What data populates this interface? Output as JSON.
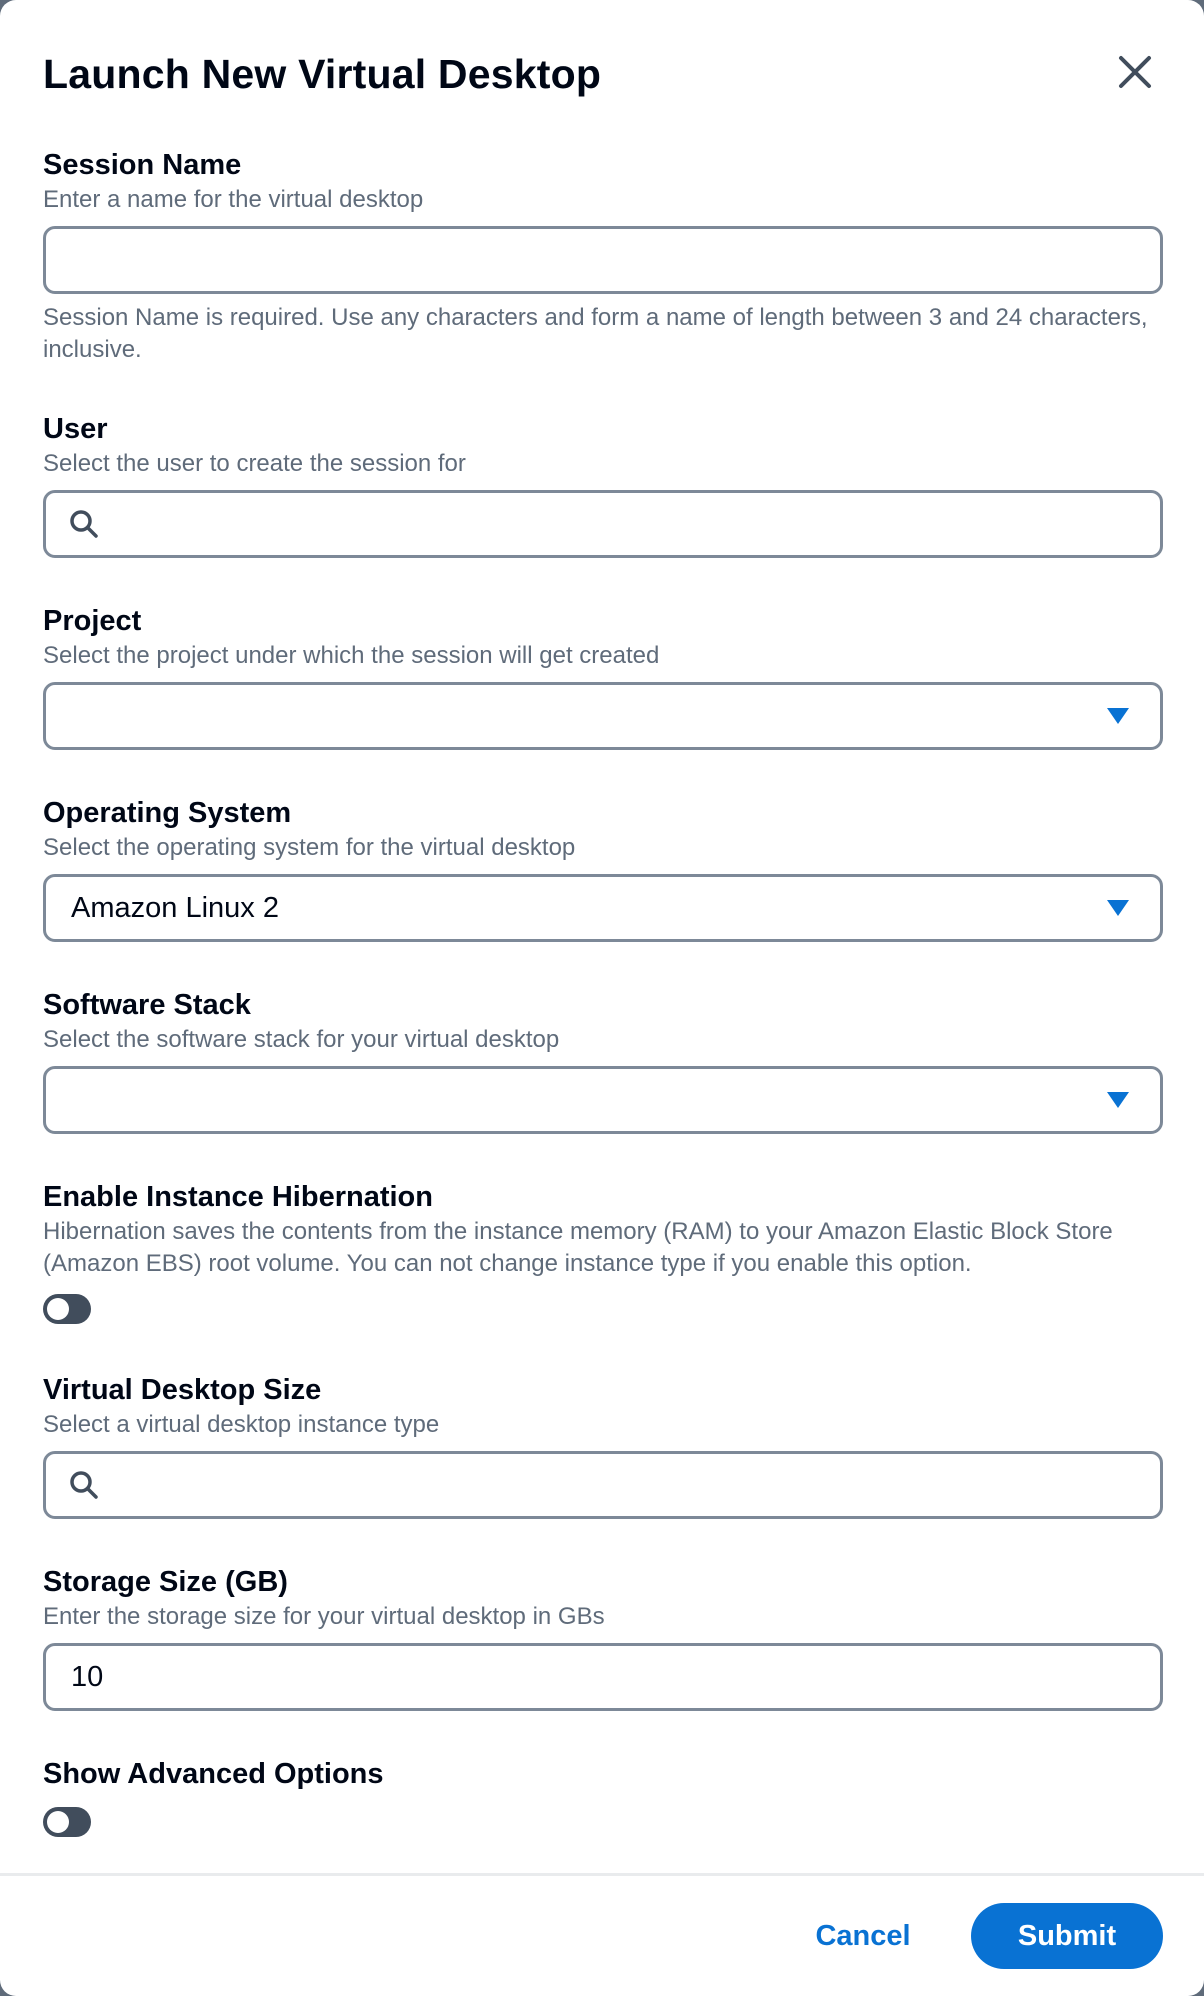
{
  "modal": {
    "title": "Launch New Virtual Desktop"
  },
  "fields": {
    "session_name": {
      "label": "Session Name",
      "description": "Enter a name for the virtual desktop",
      "value": "",
      "hint": "Session Name is required. Use any characters and form a name of length between 3 and 24 characters, inclusive."
    },
    "user": {
      "label": "User",
      "description": "Select the user to create the session for",
      "value": ""
    },
    "project": {
      "label": "Project",
      "description": "Select the project under which the session will get created",
      "value": ""
    },
    "operating_system": {
      "label": "Operating System",
      "description": "Select the operating system for the virtual desktop",
      "value": "Amazon Linux 2"
    },
    "software_stack": {
      "label": "Software Stack",
      "description": "Select the software stack for your virtual desktop",
      "value": ""
    },
    "hibernation": {
      "label": "Enable Instance Hibernation",
      "description": "Hibernation saves the contents from the instance memory (RAM) to your Amazon Elastic Block Store (Amazon EBS) root volume. You can not change instance type if you enable this option.",
      "enabled": false
    },
    "desktop_size": {
      "label": "Virtual Desktop Size",
      "description": "Select a virtual desktop instance type",
      "value": ""
    },
    "storage_size": {
      "label": "Storage Size (GB)",
      "description": "Enter the storage size for your virtual desktop in GBs",
      "value": "10"
    },
    "advanced_options": {
      "label": "Show Advanced Options",
      "enabled": false
    }
  },
  "footer": {
    "cancel_label": "Cancel",
    "submit_label": "Submit"
  },
  "icons": {
    "close": "close-icon",
    "search": "search-icon",
    "dropdown": "caret-down-icon"
  },
  "colors": {
    "accent": "#0972d3",
    "border": "#7d8998",
    "description": "#5f6b7a",
    "toggle_off": "#414d5c"
  }
}
